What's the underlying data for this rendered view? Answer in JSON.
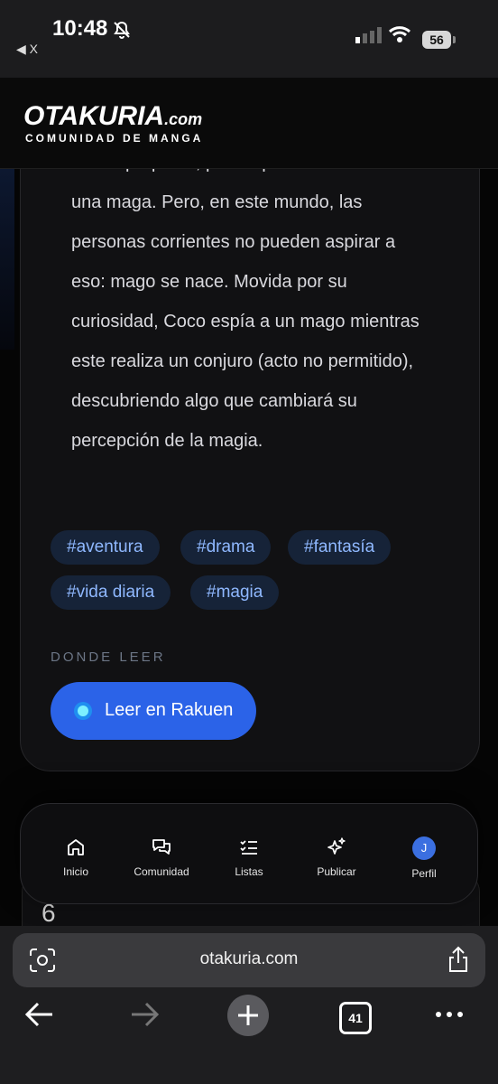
{
  "status_bar": {
    "time": "10:48",
    "back_app": "◀ X",
    "battery": "56",
    "icons": [
      "bell-slash-icon",
      "signal-icon",
      "wifi-icon",
      "battery-icon"
    ]
  },
  "site": {
    "logo_main": "OTAKURIA",
    "logo_domain": ".com",
    "logo_sub": "COMUNIDAD DE MANGA",
    "accent": "#2b63e8"
  },
  "synopsis": {
    "lines": [
      "desde pequeña, por lo que sueña con ser",
      "una maga. Pero, en este mundo, las",
      "personas corrientes no pueden aspirar a",
      "eso: mago se nace. Movida por su",
      "curiosidad, Coco espía a un mago mientras",
      "este realiza un conjuro (acto no permitido),",
      "descubriendo algo que cambiará su",
      "percepción de la magia."
    ]
  },
  "tags": [
    "#aventura",
    "#drama",
    "#fantasía",
    "#vida diaria",
    "#magia"
  ],
  "where_to_read": {
    "label": "DONDE LEER",
    "button": "Leer en Rakuen"
  },
  "next_item_rank": "6",
  "bottom_nav": {
    "items": [
      {
        "label": "Inicio",
        "icon": "home-icon"
      },
      {
        "label": "Comunidad",
        "icon": "chat-icon"
      },
      {
        "label": "Listas",
        "icon": "list-check-icon"
      },
      {
        "label": "Publicar",
        "icon": "sparkles-icon"
      },
      {
        "label": "Perfil",
        "icon": "avatar",
        "avatar_letter": "J"
      }
    ]
  },
  "browser": {
    "url": "otakuria.com",
    "tab_count": "41"
  }
}
